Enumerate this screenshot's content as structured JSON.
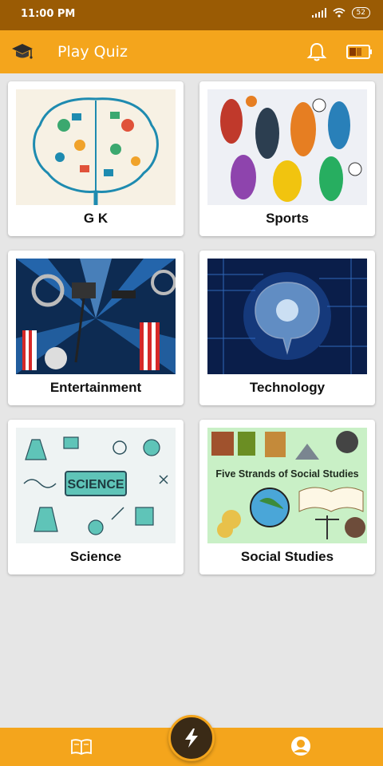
{
  "status_bar": {
    "time": "11:00 PM",
    "battery_level": "52"
  },
  "app_bar": {
    "title": "Play Quiz"
  },
  "categories": [
    {
      "label": "G K",
      "image": "brain-doodle-illustration"
    },
    {
      "label": "Sports",
      "image": "athletes-collage"
    },
    {
      "label": "Entertainment",
      "image": "cinema-popcorn-illustration"
    },
    {
      "label": "Technology",
      "image": "digital-brain-circuit"
    },
    {
      "label": "Science",
      "image": "science-doodle-board"
    },
    {
      "label": "Social Studies",
      "image": "social-studies-collage"
    }
  ],
  "category_images": {
    "social_studies_caption": "Five Strands of Social Studies",
    "science_caption": "SCIENCE"
  },
  "bottom_nav": {
    "left_icon": "book-icon",
    "center_icon": "lightning-icon",
    "right_icon": "profile-icon"
  },
  "colors": {
    "accent": "#f4a51c",
    "status_bar": "#9a5b04",
    "background": "#e6e6e6"
  }
}
